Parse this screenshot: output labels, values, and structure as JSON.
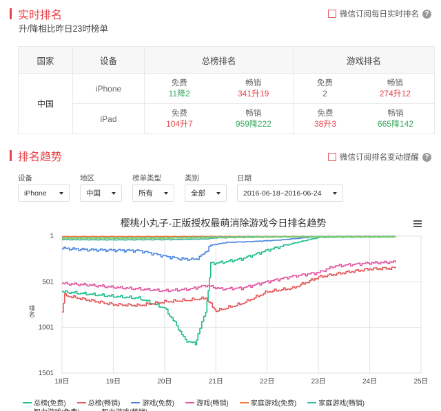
{
  "realtime": {
    "title": "实时排名",
    "subtitle": "升/降相比昨日23时榜单",
    "subscribe_label": "微信订阅每日实时排名",
    "help": "?"
  },
  "table": {
    "headers": [
      "国家",
      "设备",
      "总榜排名",
      "游戏排名"
    ],
    "country": "中国",
    "rows": [
      {
        "device": "iPhone",
        "total_free_label": "免费",
        "total_free": "11降2",
        "total_paid_label": "畅销",
        "total_paid": "341升19",
        "game_free_label": "免费",
        "game_free": "2",
        "game_paid_label": "畅销",
        "game_paid": "274升12"
      },
      {
        "device": "iPad",
        "total_free_label": "免费",
        "total_free": "104升7",
        "total_paid_label": "畅销",
        "total_paid": "959降222",
        "game_free_label": "免费",
        "game_free": "38升3",
        "game_paid_label": "畅销",
        "game_paid": "665降142"
      }
    ]
  },
  "trend": {
    "title": "排名趋势",
    "subscribe_label": "微信订阅排名变动提醒",
    "help": "?",
    "filters": [
      {
        "label": "设备",
        "value": "iPhone"
      },
      {
        "label": "地区",
        "value": "中国"
      },
      {
        "label": "榜单类型",
        "value": "所有"
      },
      {
        "label": "类别",
        "value": "全部"
      },
      {
        "label": "日期",
        "value": "2016-06-18~2016-06-24"
      }
    ]
  },
  "chart_data": {
    "type": "line",
    "title": "樱桃小丸子-正版授权最萌消除游戏今日排名趋势",
    "ylabel": "排名",
    "y_reversed": true,
    "ylim": [
      1,
      1501
    ],
    "yticks": [
      "1",
      "501",
      "1001",
      "1501"
    ],
    "xticks": [
      "18日",
      "19日",
      "20日",
      "21日",
      "22日",
      "23日",
      "24日",
      "25日"
    ],
    "grid": true,
    "legend_position": "bottom",
    "series": [
      {
        "name": "总榜(免费)",
        "color": "#1dbd8c",
        "points": [
          [
            18,
            610
          ],
          [
            18.4,
            630
          ],
          [
            19,
            660
          ],
          [
            19.5,
            680
          ],
          [
            20,
            790
          ],
          [
            20.2,
            950
          ],
          [
            20.4,
            1140
          ],
          [
            20.6,
            1180
          ],
          [
            20.65,
            1070
          ],
          [
            20.8,
            820
          ],
          [
            20.85,
            600
          ],
          [
            20.9,
            300
          ],
          [
            21.1,
            290
          ],
          [
            21.5,
            250
          ],
          [
            22,
            155
          ],
          [
            22.5,
            80
          ],
          [
            23,
            15
          ],
          [
            23.5,
            12
          ],
          [
            24,
            12
          ],
          [
            24.5,
            11
          ]
        ]
      },
      {
        "name": "总榜(畅销)",
        "color": "#e55658",
        "points": [
          [
            18,
            820
          ],
          [
            18.05,
            650
          ],
          [
            18.5,
            700
          ],
          [
            19,
            750
          ],
          [
            19.5,
            760
          ],
          [
            20,
            720
          ],
          [
            20.5,
            700
          ],
          [
            20.8,
            680
          ],
          [
            21,
            820
          ],
          [
            21.5,
            740
          ],
          [
            22,
            610
          ],
          [
            22.5,
            570
          ],
          [
            23,
            450
          ],
          [
            23.5,
            400
          ],
          [
            24,
            360
          ],
          [
            24.5,
            350
          ]
        ]
      },
      {
        "name": "游戏(免费)",
        "color": "#4a86e0",
        "points": [
          [
            18,
            135
          ],
          [
            18.5,
            150
          ],
          [
            19,
            155
          ],
          [
            19.5,
            160
          ],
          [
            20,
            220
          ],
          [
            20.3,
            250
          ],
          [
            20.6,
            255
          ],
          [
            20.75,
            200
          ],
          [
            20.9,
            100
          ],
          [
            21.2,
            70
          ],
          [
            21.7,
            60
          ],
          [
            22.2,
            45
          ],
          [
            22.7,
            20
          ],
          [
            23,
            5
          ],
          [
            23.5,
            3
          ],
          [
            24,
            3
          ],
          [
            24.5,
            2
          ]
        ]
      },
      {
        "name": "游戏(畅销)",
        "color": "#e0559e",
        "points": [
          [
            18,
            520
          ],
          [
            18.5,
            535
          ],
          [
            19,
            560
          ],
          [
            19.5,
            580
          ],
          [
            20,
            600
          ],
          [
            20.5,
            580
          ],
          [
            20.8,
            540
          ],
          [
            21.1,
            580
          ],
          [
            21.5,
            570
          ],
          [
            22,
            500
          ],
          [
            22.5,
            440
          ],
          [
            23,
            400
          ],
          [
            23.3,
            330
          ],
          [
            23.7,
            310
          ],
          [
            24,
            295
          ],
          [
            24.5,
            285
          ]
        ]
      },
      {
        "name": "家庭游戏(免费)",
        "color": "#f07a3a",
        "points": [
          [
            18,
            5
          ],
          [
            19,
            5
          ],
          [
            20,
            5
          ],
          [
            21,
            4
          ],
          [
            22,
            4
          ],
          [
            23,
            4
          ],
          [
            24,
            4
          ],
          [
            24.5,
            4
          ]
        ]
      },
      {
        "name": "家庭游戏(畅销)",
        "color": "#3cb3a3",
        "points": [
          [
            18,
            40
          ],
          [
            19,
            42
          ],
          [
            20,
            40
          ],
          [
            20.8,
            32
          ],
          [
            21,
            20
          ],
          [
            22,
            12
          ],
          [
            23,
            8
          ],
          [
            24,
            8
          ],
          [
            24.5,
            8
          ]
        ]
      },
      {
        "name": "智力游戏(免费)",
        "color": "#5ac2c6",
        "points": [
          [
            18,
            18
          ],
          [
            19,
            18
          ],
          [
            20,
            17
          ],
          [
            21,
            10
          ],
          [
            22,
            6
          ],
          [
            23,
            5
          ],
          [
            24,
            5
          ],
          [
            24.5,
            5
          ]
        ]
      },
      {
        "name": "智力游戏(畅销)",
        "color": "#8bcf5c",
        "points": [
          [
            18,
            25
          ],
          [
            19,
            25
          ],
          [
            20,
            24
          ],
          [
            21,
            15
          ],
          [
            22,
            10
          ],
          [
            23,
            9
          ],
          [
            24,
            9
          ],
          [
            24.5,
            9
          ]
        ]
      }
    ]
  }
}
